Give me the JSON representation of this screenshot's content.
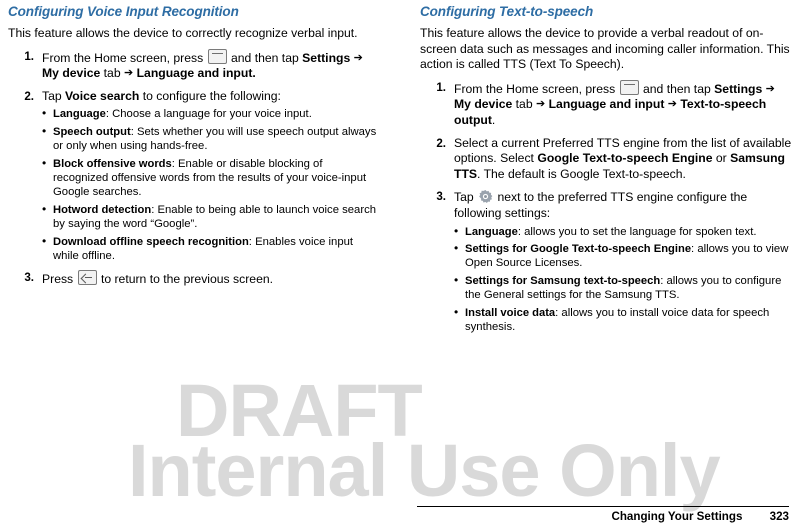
{
  "left_column": {
    "title": "Configuring Voice Input Recognition",
    "intro": "This feature allows the device to correctly recognize verbal input.",
    "steps": [
      {
        "num": "1.",
        "text_before": "From the Home screen, press",
        "icon": "menu-icon",
        "text_mid": "and then tap",
        "bold1": "Settings",
        "arrow1": "➔",
        "bold2": "My device",
        "text_after2": "tab",
        "arrow2": "➔",
        "bold3": "Language and input."
      },
      {
        "num": "2.",
        "text_before": "Tap",
        "bold1": "Voice search",
        "text_after": "to configure the following:",
        "bullets": [
          {
            "term": "Language",
            "text": ": Choose a language for your voice input."
          },
          {
            "term": "Speech output",
            "text": ": Sets whether you will use speech output always or only when using hands-free."
          },
          {
            "term": "Block offensive words",
            "text": ": Enable or disable blocking of recognized offensive words from the results of your voice-input Google searches."
          },
          {
            "term": "Hotword detection",
            "text": ": Enable to being able to launch voice search by saying the word “Google”."
          },
          {
            "term": "Download offline speech recognition",
            "text": ": Enables voice input while offline."
          }
        ]
      },
      {
        "num": "3.",
        "text_before": "Press",
        "icon": "back-icon",
        "text_after": "to return to the previous screen."
      }
    ]
  },
  "right_column": {
    "title": "Configuring Text-to-speech",
    "intro": "This feature allows the device to provide a verbal readout of on-screen data such as messages and incoming caller information. This action is called TTS (Text To Speech).",
    "steps": [
      {
        "num": "1.",
        "text_before": "From the Home screen, press",
        "icon": "menu-icon",
        "text_mid": "and then tap",
        "bold1": "Settings",
        "arrow1": "➔",
        "bold2": "My device",
        "text_after2": "tab",
        "arrow2": "➔",
        "bold3": "Language and input",
        "arrow3": "➔",
        "bold4": "Text-to-speech output",
        "period": "."
      },
      {
        "num": "2.",
        "text_line1": "Select a current Preferred TTS engine from the list of available options. Select",
        "bold1": "Google Text-to-speech Engine",
        "text_mid": "or",
        "bold2": "Samsung TTS",
        "text_after": ". The default is Google Text-to-speech."
      },
      {
        "num": "3.",
        "text_before": "Tap",
        "icon": "gear-icon",
        "text_after": "next to the preferred TTS engine configure the following settings:",
        "bullets": [
          {
            "term": "Language",
            "text": ": allows you to set the language for spoken text."
          },
          {
            "term": "Settings for Google Text-to-speech Engine",
            "text": ": allows you to view Open Source Licenses."
          },
          {
            "term": "Settings for Samsung text-to-speech",
            "text": ": allows you to configure the General settings for the Samsung TTS."
          },
          {
            "term": "Install voice data",
            "text": ": allows you to install voice data for speech synthesis."
          }
        ]
      }
    ]
  },
  "watermark": {
    "line1": "DRAFT",
    "line2": "Internal Use Only"
  },
  "footer": {
    "chapter": "Changing Your Settings",
    "page": "323"
  },
  "colors": {
    "heading": "#2e6da4",
    "watermark": "#d9d9d9",
    "text": "#000000"
  }
}
